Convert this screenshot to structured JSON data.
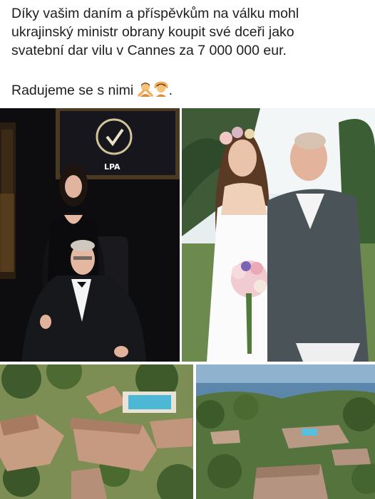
{
  "post": {
    "lines": [
      "Díky vašim daním a příspěvkům na válku mohl",
      "ukrajinský ministr obrany koupit své dceři jako",
      "svatební dar vilu v Cannes za 7 000 000 eur.",
      "Radujeme se s nimi"
    ],
    "trailing_punctuation": ".",
    "emojis": [
      "person-gesturing-no-emoji",
      "person-gesturing-ok-emoji"
    ]
  },
  "photos": {
    "minister_logo_text": "LPA"
  },
  "colors": {
    "text": "#1c1e21",
    "background": "#ffffff"
  }
}
